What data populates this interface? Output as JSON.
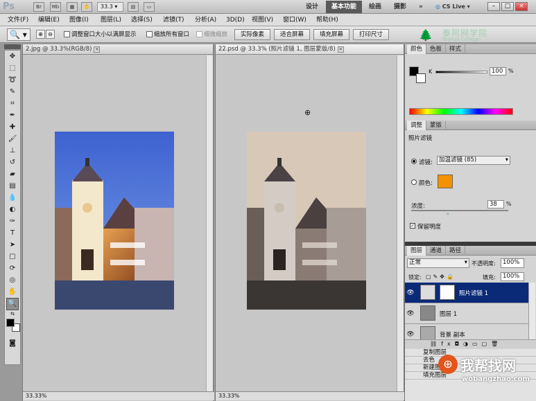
{
  "appbar": {
    "logo": "Ps",
    "zoom": "33.3",
    "workspaces": [
      "设计",
      "基本功能",
      "绘画",
      "摄影"
    ],
    "active_workspace": "基本功能",
    "more": "»",
    "cslive": "CS Live",
    "win_min": "–",
    "win_max": "□",
    "win_close": "×"
  },
  "menus": [
    "文件(F)",
    "编辑(E)",
    "图像(I)",
    "图层(L)",
    "选择(S)",
    "滤镜(T)",
    "分析(A)",
    "3D(D)",
    "视图(V)",
    "窗口(W)",
    "帮助(H)"
  ],
  "options": {
    "chk1": "调整窗口大小以满屏显示",
    "chk2": "缩放所有窗口",
    "chk3": "细微缩放",
    "btn1": "实际像素",
    "btn2": "适合屏幕",
    "btn3": "填充屏幕",
    "btn4": "打印尺寸"
  },
  "watermark1": {
    "cn": "泰阿网学院",
    "en": "Teahua College"
  },
  "docs": [
    {
      "title": "2.jpg @ 33.3%(RGB/8)",
      "close": "×",
      "status": "33.33%"
    },
    {
      "title": "22.psd @ 33.3% (照片滤镜 1, 图层蒙版/8)",
      "close": "×",
      "status": "33.33%"
    }
  ],
  "color_panel": {
    "tabs": [
      "颜色",
      "色板",
      "样式"
    ],
    "channel": "K",
    "value": "100",
    "unit": "%"
  },
  "adjust_panel": {
    "tabs": [
      "调整",
      "蒙版"
    ],
    "title": "照片滤镜",
    "filter_label": "滤镜:",
    "filter_value": "加温滤镜 (85)",
    "color_label": "颜色:",
    "color_swatch": "#f39200",
    "density_label": "浓度:",
    "density_value": "38",
    "density_unit": "%",
    "preserve_label": "保留明度"
  },
  "layers_panel": {
    "tabs": [
      "图层",
      "通道",
      "路径"
    ],
    "blend": "正常",
    "opacity_label": "不透明度:",
    "opacity": "100%",
    "lock_label": "锁定:",
    "fill_label": "填充:",
    "fill": "100%",
    "layers": [
      "照片滤镜 1",
      "图层 1",
      "背景 副本"
    ]
  },
  "history_panel": {
    "items": [
      "复制图层",
      "去色",
      "新建图层",
      "填充图层"
    ]
  },
  "watermark2": {
    "cn": "我帮找网",
    "en": "wobangzhao.com"
  }
}
